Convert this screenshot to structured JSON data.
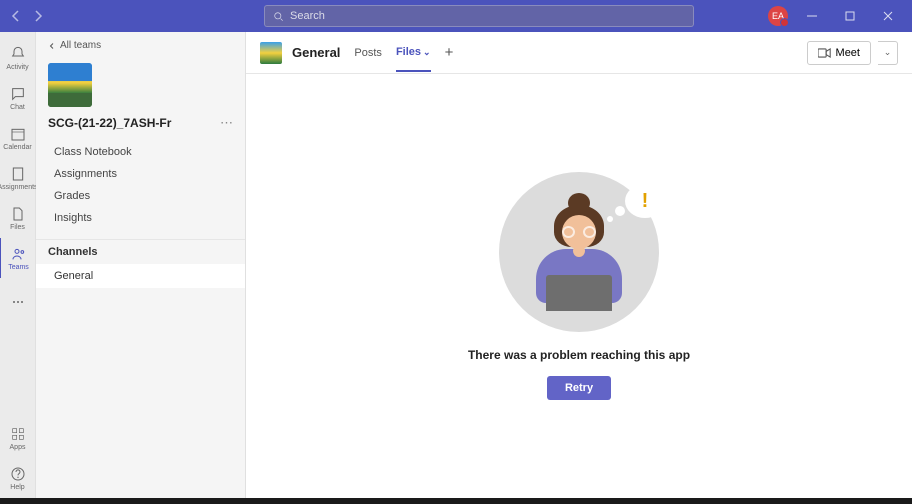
{
  "titlebar": {
    "search_placeholder": "Search",
    "avatar_initials": "EA"
  },
  "apprail": {
    "items": [
      {
        "label": "Activity"
      },
      {
        "label": "Chat"
      },
      {
        "label": "Calendar"
      },
      {
        "label": "Assignments"
      },
      {
        "label": "Files"
      },
      {
        "label": "Teams"
      }
    ],
    "bottom": [
      {
        "label": "Apps"
      },
      {
        "label": "Help"
      }
    ]
  },
  "left": {
    "back": "All teams",
    "team_name": "SCG-(21-22)_7ASH-Fr",
    "sections": [
      "Class Notebook",
      "Assignments",
      "Grades",
      "Insights"
    ],
    "channels_label": "Channels",
    "channels": [
      "General"
    ]
  },
  "content": {
    "channel_name": "General",
    "tabs": [
      "Posts",
      "Files"
    ],
    "active_tab": "Files",
    "meet_label": "Meet",
    "error_message": "There was a problem reaching this app",
    "retry_label": "Retry"
  }
}
